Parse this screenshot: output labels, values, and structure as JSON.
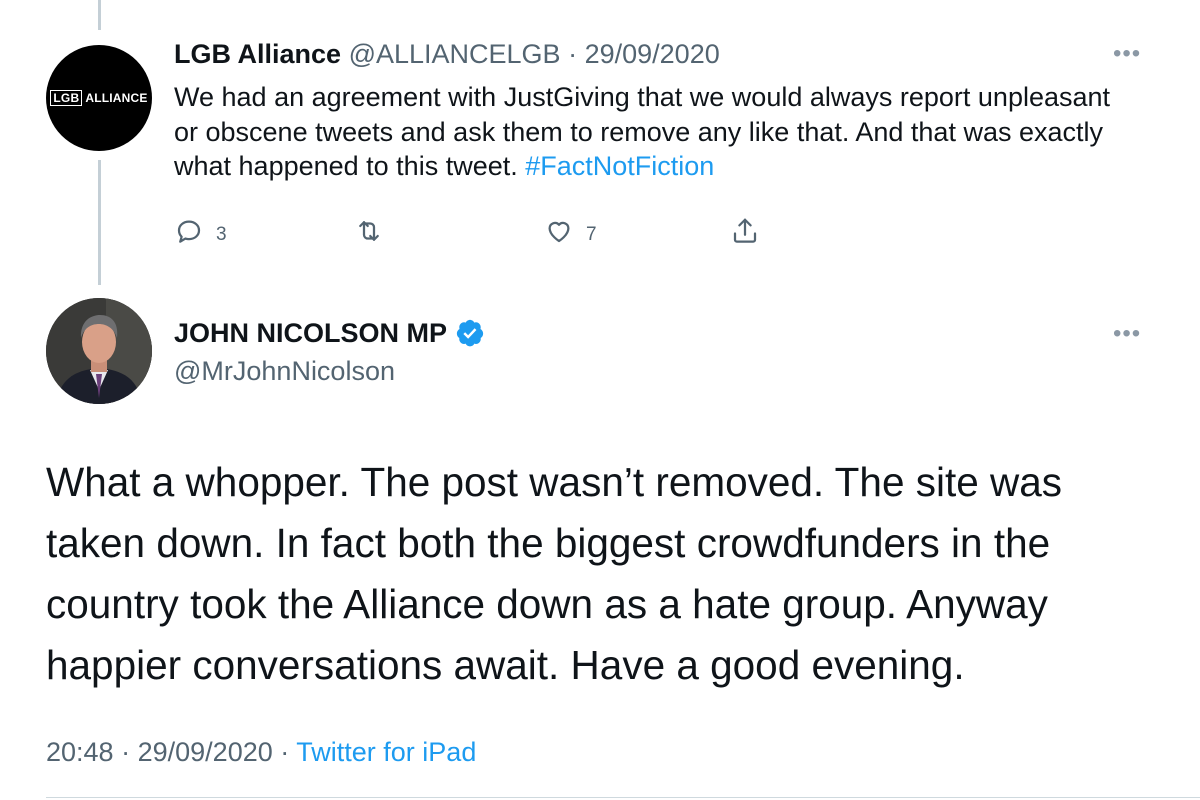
{
  "parent_tweet": {
    "avatar_text": [
      "LGB",
      "ALLIANCE"
    ],
    "author_name": "LGB Alliance",
    "handle": "@ALLIANCELGB",
    "separator": "·",
    "date": "29/09/2020",
    "more_label": "•••",
    "body_text": "We had an agreement with JustGiving that we would always report unpleasant or obscene tweets and ask them to remove any like that. And that was exactly what happened to this tweet. ",
    "hashtag": "#FactNotFiction",
    "actions": {
      "reply_count": "3",
      "retweet_count": "",
      "like_count": "7"
    }
  },
  "main_tweet": {
    "author_name": "JOHN NICOLSON MP",
    "verified": true,
    "handle": "@MrJohnNicolson",
    "more_label": "•••",
    "body_text": "What a whopper. The post wasn’t removed. The site was taken down. In fact both the biggest crowdfunders in the country took the Alliance down as a hate group. Anyway happier conversations await. Have a good evening.",
    "time": "20:48",
    "separator": "·",
    "date": "29/09/2020",
    "source": "Twitter for iPad"
  },
  "colors": {
    "text_primary": "#0f1419",
    "text_secondary": "#536471",
    "link_blue": "#1d9bf0",
    "verified_blue": "#1d9bf0",
    "thread_line": "#c4cfd6"
  },
  "icons": {
    "reply": "speech-bubble-icon",
    "retweet": "retweet-icon",
    "like": "heart-icon",
    "share": "share-upload-icon",
    "more": "more-dots-icon",
    "verified": "verified-badge-icon"
  }
}
